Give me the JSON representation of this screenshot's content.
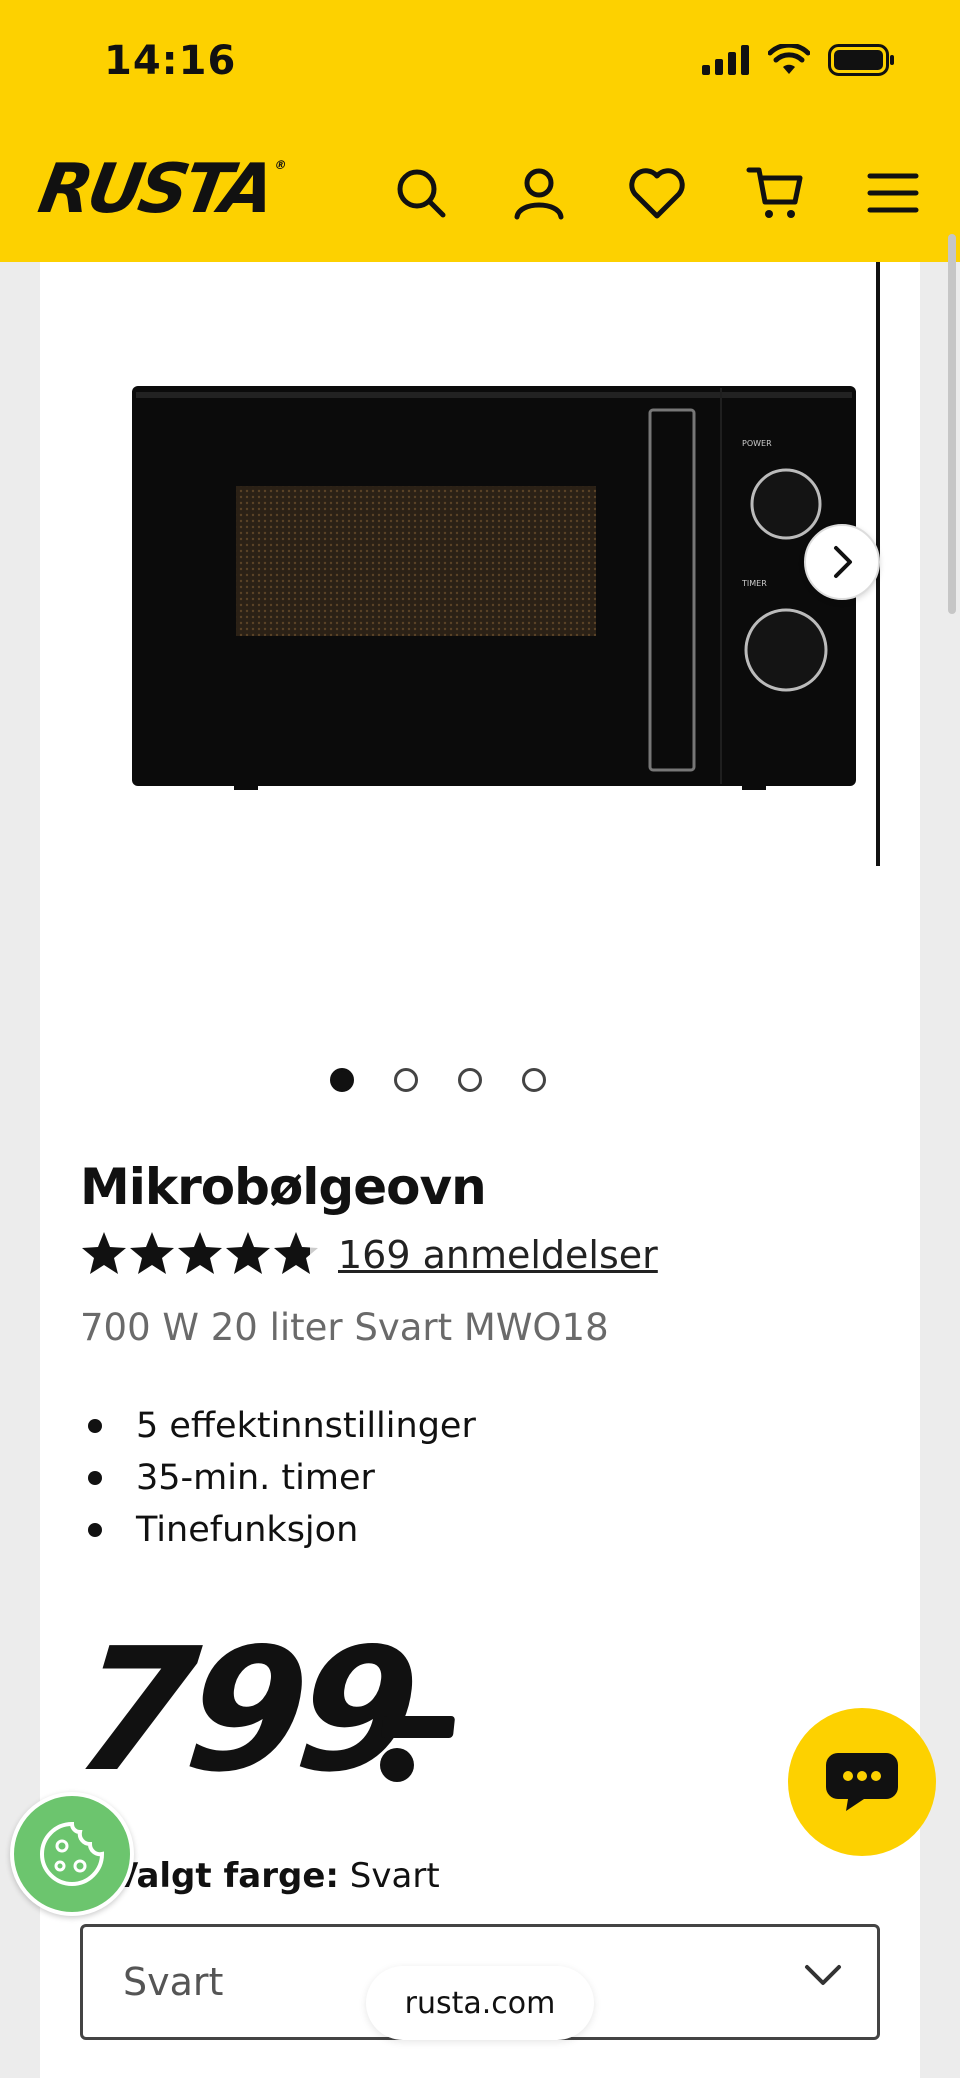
{
  "status_bar": {
    "time": "14:16"
  },
  "header": {
    "logo": "RUSTA",
    "icons": [
      "search-icon",
      "account-icon",
      "heart-icon",
      "cart-icon",
      "menu-icon"
    ]
  },
  "carousel": {
    "total_images": 4,
    "active_index": 0
  },
  "product": {
    "title": "Mikrobølgeovn",
    "rating": 4.8,
    "reviews_label": "169 anmeldelser",
    "subtitle": "700 W 20 liter Svart MWO18",
    "features": [
      "5 effektinnstillinger",
      "35-min. timer",
      "Tinefunksjon"
    ],
    "price": "799"
  },
  "color": {
    "label": "Valgt farge:",
    "value": "Svart",
    "select_value": "Svart"
  },
  "browser": {
    "url": "rusta.com"
  },
  "colors": {
    "brand_yellow": "#fdd100",
    "cookie_green": "#6cc56e"
  }
}
